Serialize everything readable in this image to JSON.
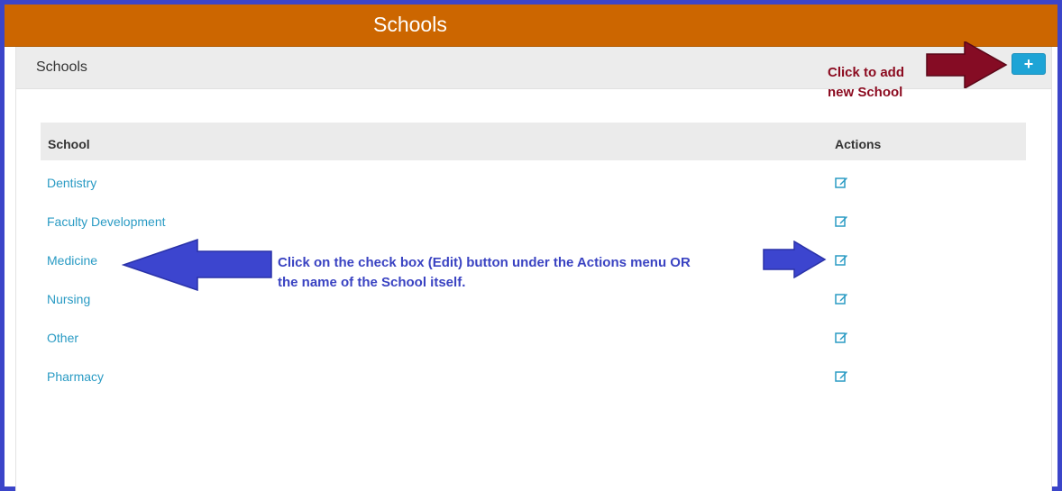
{
  "header": {
    "title": "Schools"
  },
  "panel": {
    "title": "Schools"
  },
  "toolbar": {
    "add_label": "+"
  },
  "table": {
    "columns": [
      "School",
      "Actions"
    ],
    "rows": [
      {
        "name": "Dentistry",
        "action_icon": "edit-icon"
      },
      {
        "name": "Faculty Development",
        "action_icon": "edit-icon"
      },
      {
        "name": "Medicine",
        "action_icon": "edit-icon"
      },
      {
        "name": "Nursing",
        "action_icon": "edit-icon"
      },
      {
        "name": "Other",
        "action_icon": "edit-icon"
      },
      {
        "name": "Pharmacy",
        "action_icon": "edit-icon"
      }
    ]
  },
  "annotations": {
    "add_hint": "Click to add\nnew School",
    "edit_hint": "Click on the check box (Edit) button under the Actions menu OR\nthe name of the School itself."
  },
  "colors": {
    "header_bg": "#cc6600",
    "frame_border": "#3b45c9",
    "add_button": "#1ea4d6",
    "link": "#2a9bc4",
    "annotation_red": "#8b0a1f",
    "annotation_blue": "#3a43c2"
  }
}
